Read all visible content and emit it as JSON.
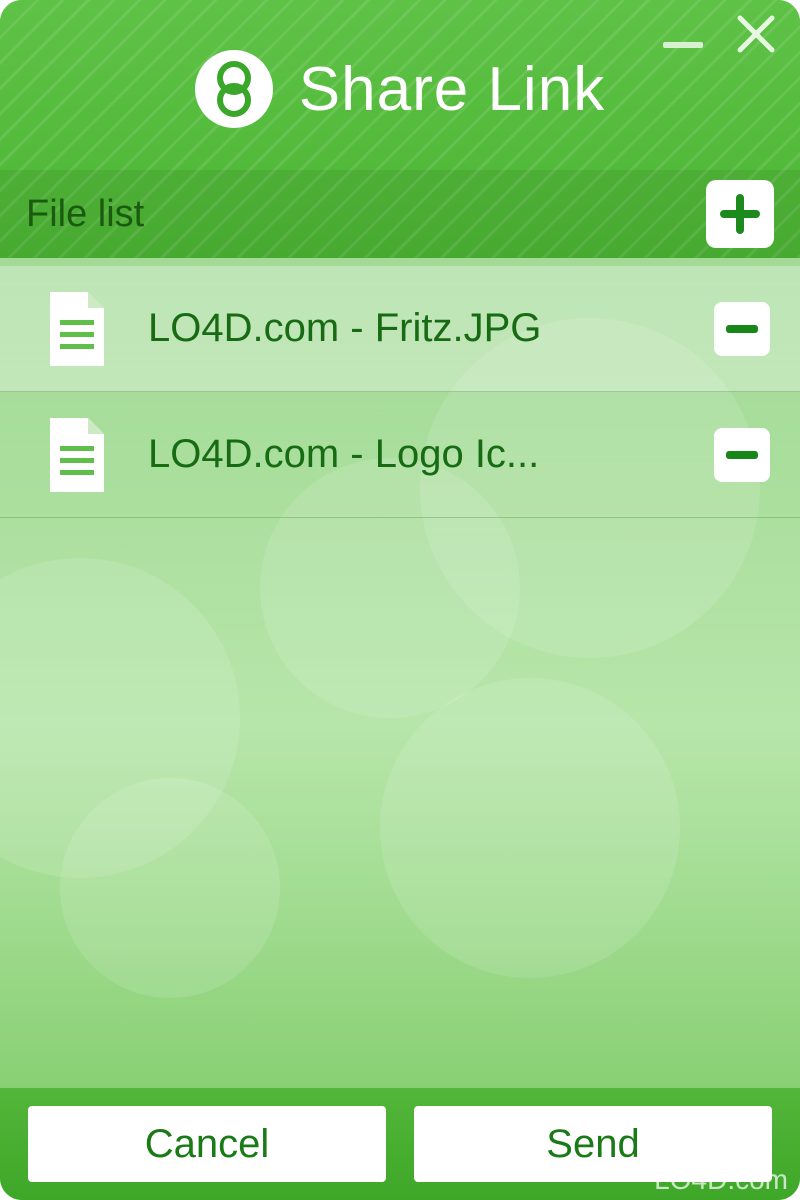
{
  "window": {
    "title": "Share Link"
  },
  "header_controls": {
    "minimize": "minimize",
    "close": "close"
  },
  "subheader": {
    "label": "File list",
    "add_button": "add-file"
  },
  "files": [
    {
      "name": "LO4D.com - Fritz.JPG"
    },
    {
      "name": "LO4D.com - Logo Ic..."
    }
  ],
  "footer": {
    "cancel_label": "Cancel",
    "send_label": "Send"
  },
  "watermark": {
    "text": "LO4D.com"
  },
  "colors": {
    "accent_green": "#4cb534",
    "text_green_dark": "#176b13",
    "icon_green": "#188618",
    "white": "#ffffff"
  }
}
